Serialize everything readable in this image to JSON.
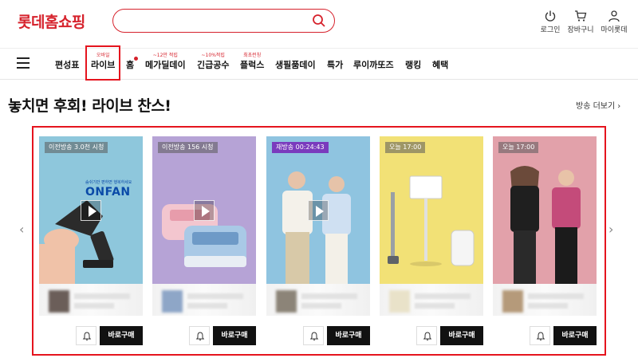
{
  "header": {
    "logo": "롯데홈쇼핑",
    "search_placeholder": "",
    "utils": [
      {
        "label": "로그인",
        "icon": "power-icon"
      },
      {
        "label": "장바구니",
        "icon": "cart-icon"
      },
      {
        "label": "마이롯데",
        "icon": "user-icon"
      }
    ]
  },
  "nav": {
    "items": [
      {
        "label": "편성표",
        "tag": ""
      },
      {
        "label": "라이브",
        "tag": "오바일"
      },
      {
        "label": "홈",
        "tag": ""
      },
      {
        "label": "메가딜데이",
        "tag": "~12만 적립"
      },
      {
        "label": "긴급공수",
        "tag": "~10%적립"
      },
      {
        "label": "플럭스",
        "tag": "최초런칭"
      },
      {
        "label": "생필품데이",
        "tag": ""
      },
      {
        "label": "특가",
        "tag": ""
      },
      {
        "label": "루이까또즈",
        "tag": ""
      },
      {
        "label": "랭킹",
        "tag": ""
      },
      {
        "label": "혜택",
        "tag": ""
      }
    ]
  },
  "section": {
    "title": "놓치면 후회! 라이브 찬스!",
    "more_label": "방송 더보기"
  },
  "cards": [
    {
      "badge": "이전방송 3.0천 시청",
      "bg": "#8ec7dc",
      "buy_label": "바로구매",
      "brand_text": "ONFAN",
      "brand_caption": "숨쉬기만 편하면 행복하세요"
    },
    {
      "badge": "이전방송 156 시청",
      "bg": "#b6a3d6",
      "buy_label": "바로구매"
    },
    {
      "badge": "재방송 00:24:43",
      "bg": "#8fc4e0",
      "buy_label": "바로구매"
    },
    {
      "badge": "오늘 17:00",
      "bg": "#f2e176",
      "buy_label": "바로구매"
    },
    {
      "badge": "오늘 17:00",
      "bg": "#e2a1aa",
      "buy_label": "바로구매"
    }
  ],
  "colors": {
    "brand": "#d6222c",
    "highlight": "#e5141e"
  }
}
